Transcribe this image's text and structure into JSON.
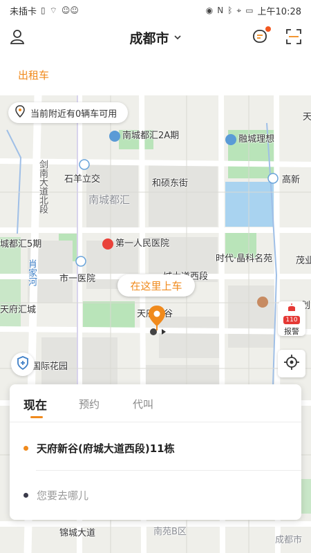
{
  "status_bar": {
    "carrier": "未插卡",
    "time": "上午10:28",
    "icons": [
      "sim-icon",
      "wifi-icon",
      "notification-icons",
      "eye-icon",
      "nfc-icon",
      "bluetooth-icon",
      "location-icon",
      "battery-icon"
    ]
  },
  "header": {
    "city": "成都市",
    "user_icon": "user-icon",
    "message_icon": "message-icon",
    "scan_icon": "scan-icon"
  },
  "service": {
    "tabs": [
      "出租车"
    ],
    "active": "出租车"
  },
  "map": {
    "availability_text": "当前附近有0辆车可用",
    "pickup_tip": "在这里上车",
    "labels": {
      "nanchengduhui2a": "南城都汇2A期",
      "ronglcheng": "融城理想",
      "shiyangjiao": "石羊立交",
      "gaoxin": "高新",
      "heshuodongjie": "和硕东街",
      "nanchengduhui": "南城都汇",
      "duhui5": "城都汇5期",
      "hospital1": "第一人民医院",
      "shidai": "时代·晶科名苑",
      "maoye": "茂业",
      "xiangjiahe": "肖家河",
      "shiyiyiyuan": "市一医院",
      "fucheng_dadao": "城大道西段",
      "tianfu_huicheng": "天府汇城",
      "tianfu_xingu": "天府新谷",
      "guoji_huayuan": "国际花园",
      "jianan_dadao": "剑南大道北段",
      "jinxiu_dadao": "锦城大道",
      "nanyuan_b": "南苑B区",
      "chengdu_right": "成都市",
      "lihua": "划",
      "tian": "天"
    },
    "alarm_badge": "110",
    "alarm_label": "报警"
  },
  "booking": {
    "tabs": [
      "现在",
      "预约",
      "代叫"
    ],
    "active_tab": "现在",
    "from": "天府新谷(府城大道西段)11栋",
    "to_placeholder": "您要去哪儿"
  },
  "colors": {
    "accent": "#f08a1c",
    "alert": "#e53935",
    "map_bg": "#efefea",
    "park": "#b9e4b9",
    "water": "#a9d3f0"
  }
}
